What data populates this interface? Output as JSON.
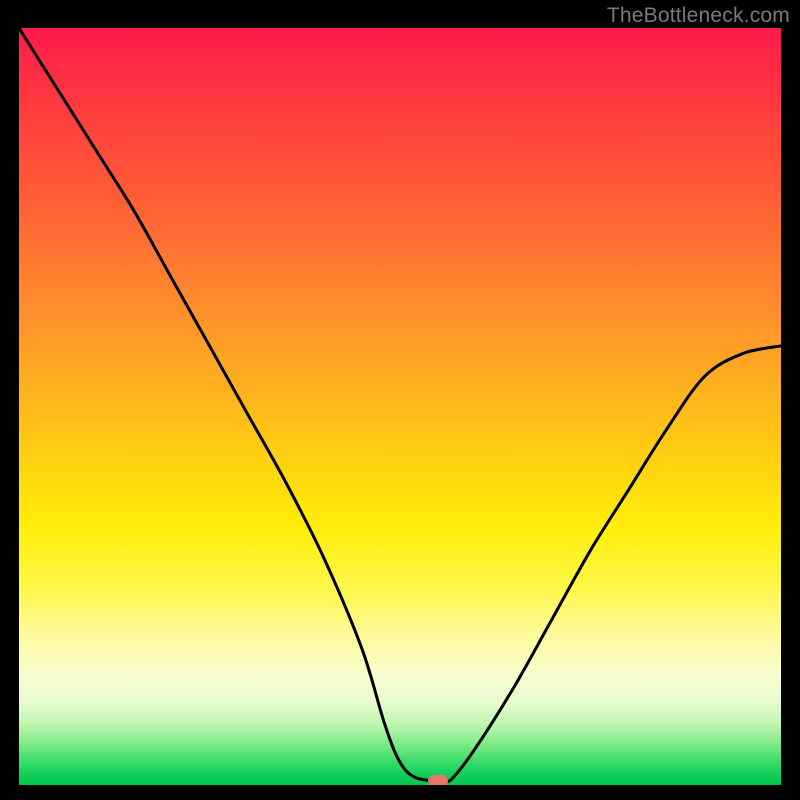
{
  "watermark": "TheBottleneck.com",
  "colors": {
    "top": "#ff1a4c",
    "mid": "#ffee0c",
    "bottom": "#00c84f",
    "curve": "#000000",
    "marker": "#e77769",
    "frame": "#000000"
  },
  "chart_data": {
    "type": "line",
    "title": "",
    "xlabel": "",
    "ylabel": "",
    "xlim": [
      0,
      100
    ],
    "ylim": [
      0,
      100
    ],
    "x": [
      0,
      5,
      10,
      15,
      20,
      25,
      30,
      35,
      40,
      45,
      48,
      50,
      52,
      55,
      56,
      57,
      60,
      65,
      70,
      75,
      80,
      85,
      90,
      95,
      100
    ],
    "values": [
      100,
      92,
      84,
      76,
      67,
      58,
      49,
      40,
      30,
      18,
      8,
      3,
      1,
      0.5,
      0.5,
      1,
      5,
      13,
      22,
      31,
      39,
      47,
      54,
      57,
      58
    ],
    "marker": {
      "x": 55,
      "y": 0.5
    },
    "notes": "V-shaped bottleneck curve on a red→yellow→green vertical gradient. Minimum (optimal point) at roughly x≈55 where the curve touches the green band; a small rounded salmon marker sits at the trough. Values are visual estimates (no axes/ticks are shown)."
  }
}
